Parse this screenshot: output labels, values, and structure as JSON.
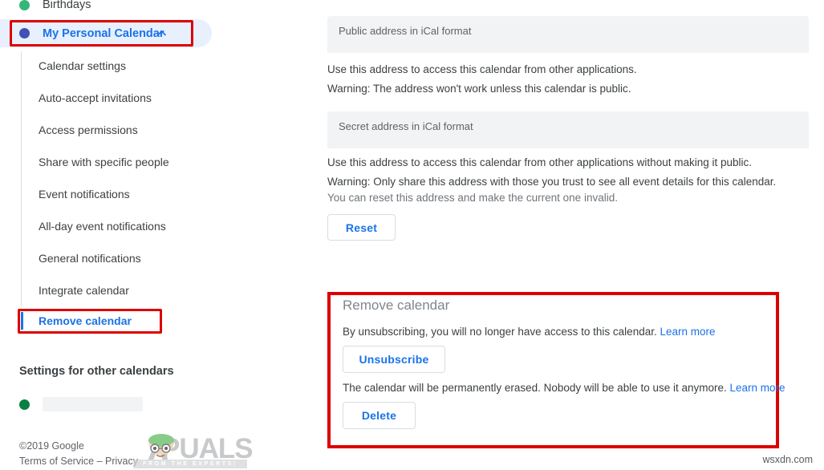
{
  "sidebar": {
    "calendars": [
      {
        "name": "Birthdays",
        "dot_color": "#33b679"
      }
    ],
    "selected_calendar": {
      "name": "My Personal Calendar",
      "dot_color": "#3f51b5",
      "caret_icon": "chevron-up-icon"
    },
    "submenu": [
      "Calendar settings",
      "Auto-accept invitations",
      "Access permissions",
      "Share with specific people",
      "Event notifications",
      "All-day event notifications",
      "General notifications",
      "Integrate calendar",
      "Remove calendar"
    ],
    "active_submenu_item": "Remove calendar",
    "other_calendars_heading": "Settings for other calendars",
    "other_calendar": {
      "name": "",
      "dot_color": "#0b8043"
    },
    "footer": {
      "copyright": "©2019 Google",
      "terms": "Terms of Service",
      "separator": " – ",
      "privacy": "Privacy"
    }
  },
  "main": {
    "public_address": {
      "label": "Public address in iCal format",
      "value": "",
      "help": "Use this address to access this calendar from other applications.",
      "warning": "Warning: The address won't work unless this calendar is public."
    },
    "secret_address": {
      "label": "Secret address in iCal format",
      "value": "",
      "help": "Use this address to access this calendar from other applications without making it public.",
      "warning": "Warning: Only share this address with those you trust to see all event details for this calendar.",
      "note": "You can reset this address and make the current one invalid.",
      "reset_label": "Reset"
    },
    "remove_calendar": {
      "title": "Remove calendar",
      "unsubscribe_text": "By unsubscribing, you will no longer have access to this calendar.",
      "unsubscribe_learn_more": "Learn more",
      "unsubscribe_label": "Unsubscribe",
      "delete_text": "The calendar will be permanently erased. Nobody will be able to use it anymore.",
      "delete_learn_more": "Learn more",
      "delete_label": "Delete"
    }
  },
  "watermark": {
    "brand": "PUALS",
    "tagline": "FROM THE EXPERTS!",
    "site": "wsxdn.com"
  },
  "colors": {
    "accent_blue": "#1a73e8",
    "highlight_red": "#dd0000",
    "selected_row_bg": "#e8f0fe",
    "field_bg": "#f1f3f4"
  }
}
